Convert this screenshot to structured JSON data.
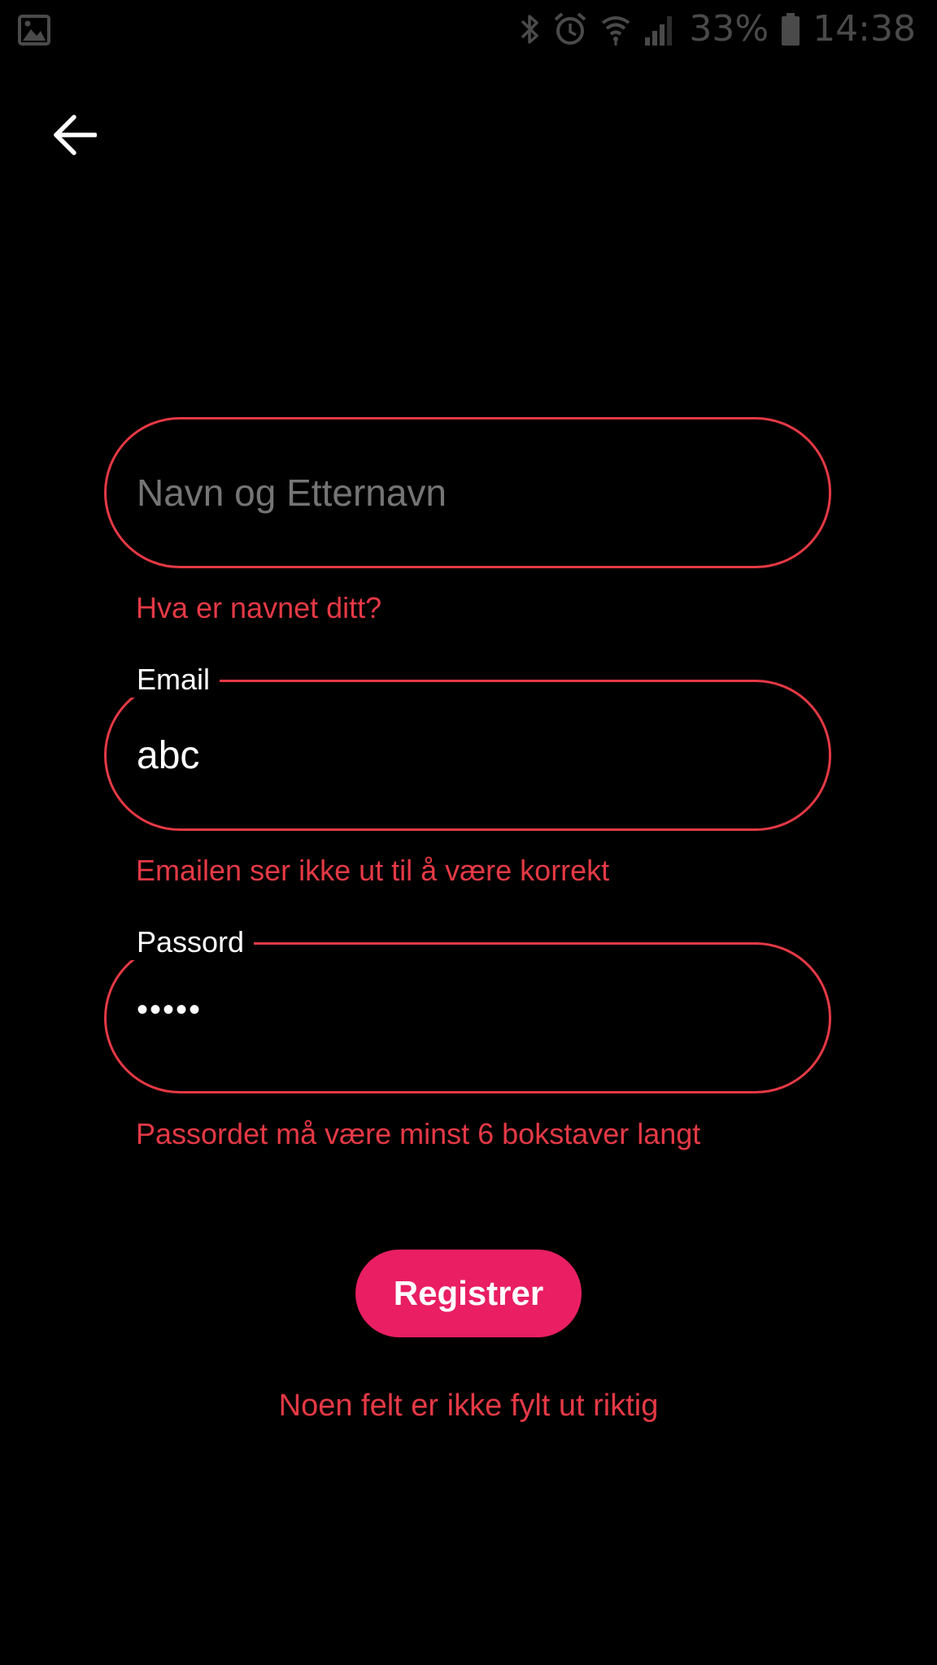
{
  "status_bar": {
    "battery_percent": "33%",
    "time": "14:38",
    "icons": [
      "gallery-icon",
      "bluetooth-icon",
      "alarm-icon",
      "wifi-icon",
      "signal-icon",
      "battery-icon"
    ]
  },
  "header": {
    "back_icon": "arrow-left-icon"
  },
  "form": {
    "name": {
      "placeholder": "Navn og Etternavn",
      "value": "",
      "helper": "Hva er navnet ditt?"
    },
    "email": {
      "label": "Email",
      "value": "abc",
      "helper": "Emailen ser ikke ut til å være korrekt"
    },
    "password": {
      "label": "Passord",
      "value": "•••••",
      "helper": "Passordet må være minst 6 bokstaver langt"
    },
    "register_label": "Registrer",
    "form_error": "Noen felt er ikke fylt ut riktig"
  },
  "colors": {
    "background": "#000000",
    "error": "#e53945",
    "accent": "#e91e63",
    "text": "#ffffff",
    "status_icons": "#4a4a4a"
  }
}
